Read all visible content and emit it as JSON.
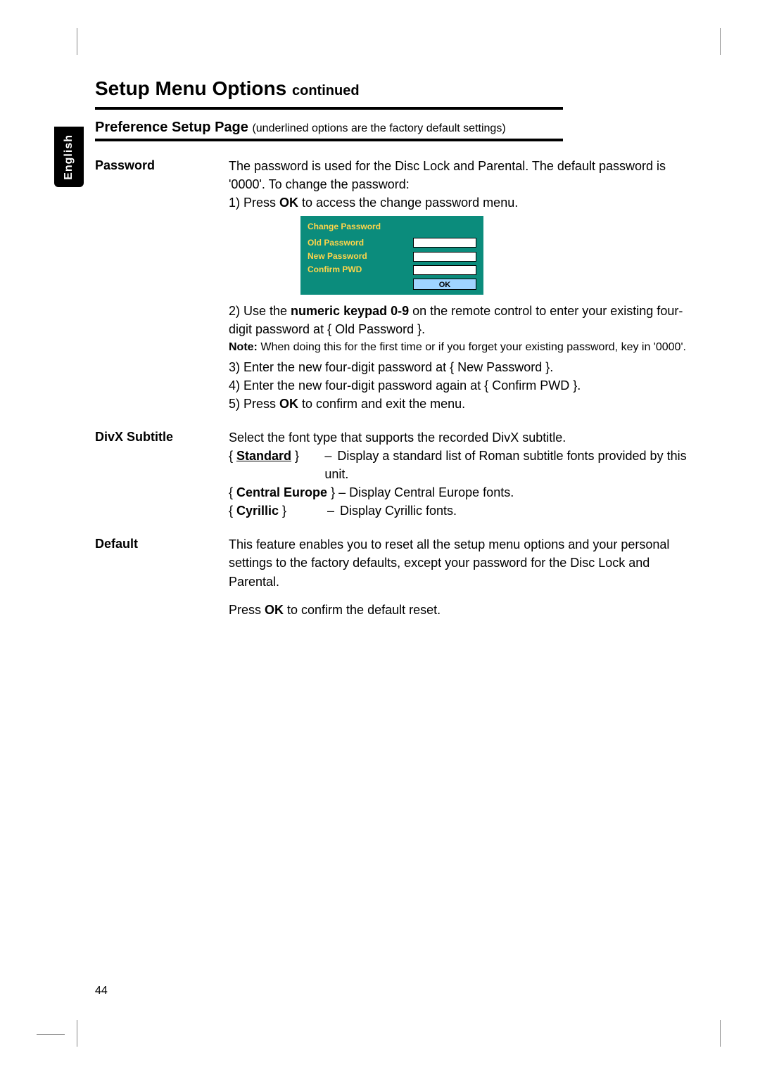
{
  "language_tab": "English",
  "page_title_main": "Setup Menu Options",
  "page_title_cont": "continued",
  "section_title_bold": "Preference Setup Page",
  "section_title_sub": "underlined options are the factory default settings",
  "password": {
    "label": "Password",
    "intro": "The password is used for the Disc Lock and Parental. The default password is '0000'.  To change the password:",
    "step1_pre": "1)  Press ",
    "step1_b": "OK",
    "step1_post": " to access the change password menu.",
    "dvd": {
      "title": "Change Password",
      "row1": "Old Password",
      "row2": "New Password",
      "row3": "Confirm PWD",
      "ok": "OK"
    },
    "step2_pre": "2)  Use the ",
    "step2_b": "numeric keypad 0-9",
    "step2_post": " on the remote control to enter your existing four-digit password at { Old Password }.",
    "note_b": "Note:",
    "note_rest": "  When doing this for the first time or if you forget your existing password, key in '0000'.",
    "step3": "3)  Enter the new four-digit password at { New Password }.",
    "step4": "4)  Enter the new four-digit password again at { Confirm PWD }.",
    "step5_pre": "5)  Press ",
    "step5_b": "OK",
    "step5_post": " to confirm and exit the menu."
  },
  "divx": {
    "label": "DivX Subtitle",
    "intro": "Select the font type that supports the recorded DivX subtitle.",
    "opt1_key_open": "{ ",
    "opt1_key_b": "Standard",
    "opt1_key_close": " }",
    "opt1_desc": "Display a standard list of Roman subtitle fonts provided by this unit.",
    "opt2_key_open": "{ ",
    "opt2_key_b": "Central Europe",
    "opt2_key_close": " }",
    "opt2_desc": "Display Central Europe fonts.",
    "opt3_key_open": "{ ",
    "opt3_key_b": "Cyrillic",
    "opt3_key_close": " }",
    "opt3_desc": "Display Cyrillic fonts."
  },
  "default": {
    "label": "Default",
    "para1": "This feature enables you to reset all the setup menu options and your personal settings to the factory defaults, except your password for the Disc Lock and Parental.",
    "para2_pre": "Press ",
    "para2_b": "OK",
    "para2_post": " to confirm the default reset."
  },
  "page_number": "44"
}
